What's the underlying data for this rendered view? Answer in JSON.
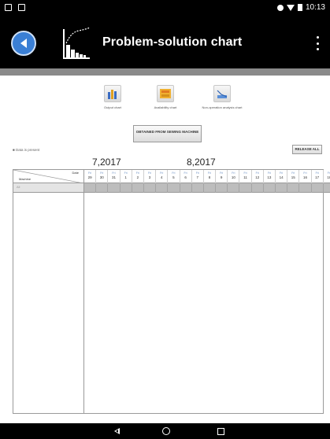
{
  "status_bar": {
    "time": "10:13"
  },
  "app_bar": {
    "title": "Problem-solution chart"
  },
  "charts": [
    {
      "label": "Output chart",
      "icon": "bar-chart-icon"
    },
    {
      "label": "Availability chart",
      "icon": "availability-chart-icon"
    },
    {
      "label": "Non-operation analysis chart",
      "icon": "line-chart-icon"
    }
  ],
  "actions": {
    "obtain_label": "OBTAINED FROM SEWING MACHINE",
    "release_all_label": "RELEASE ALL",
    "data_present_label": "■ Data is present"
  },
  "months": [
    "7,2017",
    "8,2017"
  ],
  "grid": {
    "corner_date": "Date",
    "corner_machine": "Machine",
    "filter_placeholder": "All",
    "days": [
      "29",
      "30",
      "31",
      "1",
      "2",
      "3",
      "4",
      "5",
      "6",
      "7",
      "8",
      "9",
      "10",
      "11",
      "12",
      "13",
      "14",
      "15",
      "16",
      "17",
      "18"
    ],
    "day_marker": "Fri"
  }
}
